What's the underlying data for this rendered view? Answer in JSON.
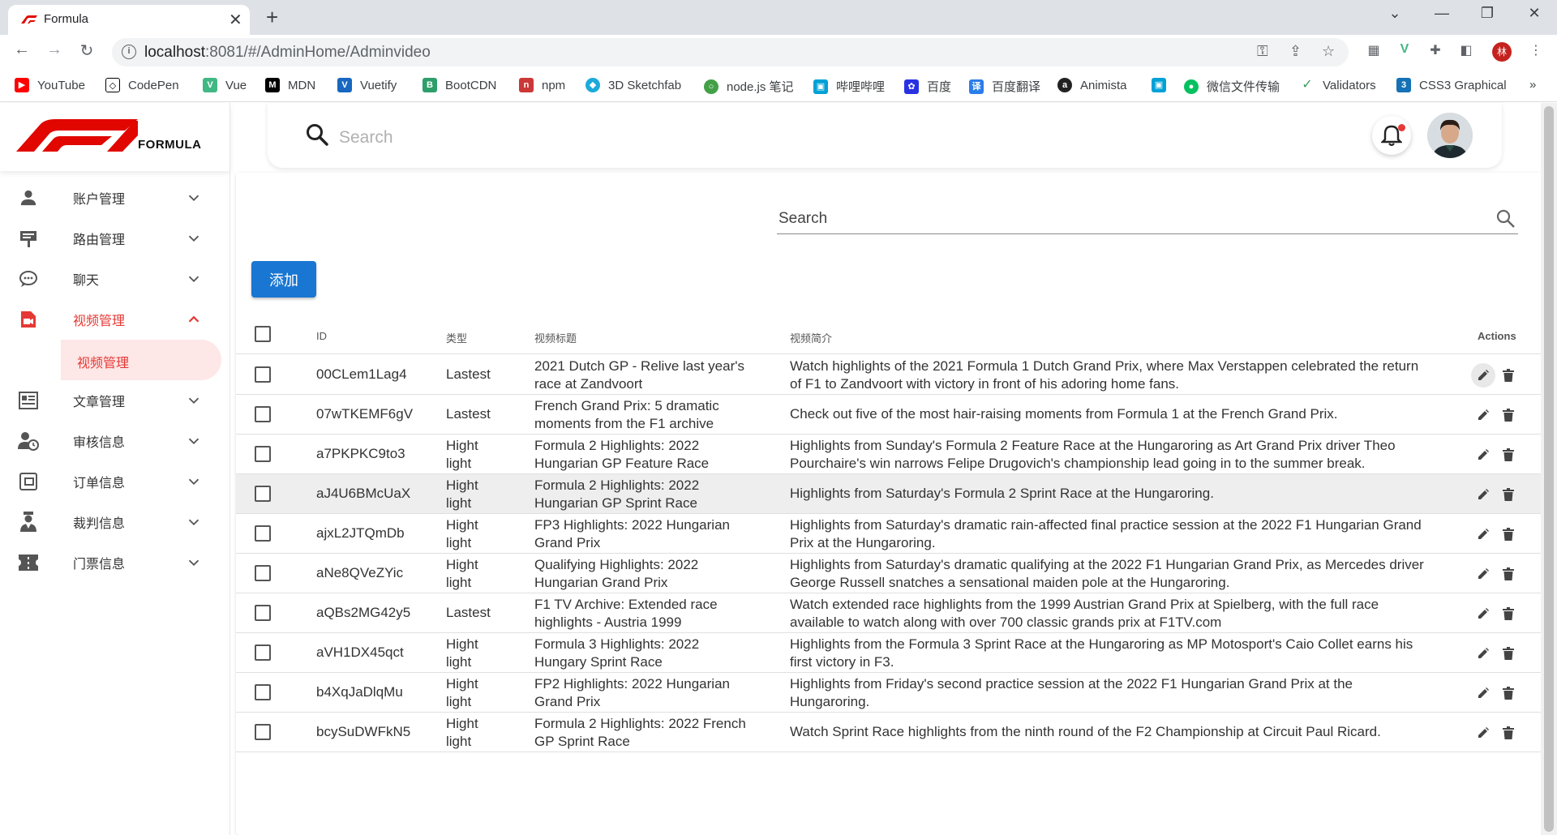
{
  "browser": {
    "tab_title": "Formula",
    "url_host": "localhost",
    "url_rest": ":8081/#/AdminHome/Adminvideo",
    "profile_initial": "林",
    "bookmarks": [
      "YouTube",
      "CodePen",
      "Vue",
      "MDN",
      "Vuetify",
      "BootCDN",
      "npm",
      "3D Sketchfab",
      "node.js 笔记",
      "哔哩哔哩",
      "百度",
      "百度翻译",
      "Animista",
      "",
      "微信文件传输",
      "Validators",
      "CSS3 Graphical"
    ],
    "more": "»"
  },
  "app": {
    "brand": "FORMULA",
    "search_placeholder": "Search",
    "nav": [
      {
        "label": "账户管理",
        "icon": "person-icon"
      },
      {
        "label": "路由管理",
        "icon": "signpost-icon"
      },
      {
        "label": "聊天",
        "icon": "chat-icon"
      },
      {
        "label": "视频管理",
        "icon": "video-icon"
      },
      {
        "label": "文章管理",
        "icon": "article-icon"
      },
      {
        "label": "审核信息",
        "icon": "user-clock-icon"
      },
      {
        "label": "订单信息",
        "icon": "order-icon"
      },
      {
        "label": "裁判信息",
        "icon": "referee-icon"
      },
      {
        "label": "门票信息",
        "icon": "ticket-icon"
      }
    ],
    "subnav_label": "视频管理",
    "accent_color": "#e53935",
    "primary_color": "#1976d2"
  },
  "table": {
    "search_label": "Search",
    "add_label": "添加",
    "headers": {
      "id": "ID",
      "type": "类型",
      "title": "视频标题",
      "desc": "视频简介",
      "actions": "Actions"
    },
    "rows": [
      {
        "id": "00CLem1Lag4",
        "type": [
          "Lastest"
        ],
        "title": [
          "2021 Dutch GP - Relive last year's",
          "race at Zandvoort"
        ],
        "desc": [
          "Watch highlights of the 2021 Formula 1 Dutch Grand Prix, where Max Verstappen celebrated the return",
          "of F1 to Zandvoort with victory in front of his adoring home fans."
        ]
      },
      {
        "id": "07wTKEMF6gV",
        "type": [
          "Lastest"
        ],
        "title": [
          "French Grand Prix: 5 dramatic",
          "moments from the F1 archive"
        ],
        "desc": [
          "Check out five of the most hair-raising moments from Formula 1 at the French Grand Prix."
        ]
      },
      {
        "id": "a7PKPKC9to3",
        "type": [
          "Hight",
          "light"
        ],
        "title": [
          "Formula 2 Highlights: 2022",
          "Hungarian GP Feature Race"
        ],
        "desc": [
          "Highlights from Sunday's Formula 2 Feature Race at the Hungaroring as Art Grand Prix driver Theo",
          "Pourchaire's win narrows Felipe Drugovich's championship lead going in to the summer break."
        ]
      },
      {
        "id": "aJ4U6BMcUaX",
        "type": [
          "Hight",
          "light"
        ],
        "title": [
          "Formula 2 Highlights: 2022",
          "Hungarian GP Sprint Race"
        ],
        "desc": [
          "Highlights from Saturday's Formula 2 Sprint Race at the Hungaroring."
        ]
      },
      {
        "id": "ajxL2JTQmDb",
        "type": [
          "Hight",
          "light"
        ],
        "title": [
          "FP3 Highlights: 2022 Hungarian",
          "Grand Prix"
        ],
        "desc": [
          "Highlights from Saturday's dramatic rain-affected final practice session at the 2022 F1 Hungarian Grand",
          "Prix at the Hungaroring."
        ]
      },
      {
        "id": "aNe8QVeZYic",
        "type": [
          "Hight",
          "light"
        ],
        "title": [
          "Qualifying Highlights: 2022",
          "Hungarian Grand Prix"
        ],
        "desc": [
          "Highlights from Saturday's dramatic qualifying at the 2022 F1 Hungarian Grand Prix, as Mercedes driver",
          "George Russell snatches a sensational maiden pole at the Hungaroring."
        ]
      },
      {
        "id": "aQBs2MG42y5",
        "type": [
          "Lastest"
        ],
        "title": [
          "F1 TV Archive: Extended race",
          "highlights - Austria 1999"
        ],
        "desc": [
          "Watch extended race highlights from the 1999 Austrian Grand Prix at Spielberg, with the full race",
          "available to watch along with over 700 classic grands prix at F1TV.com"
        ]
      },
      {
        "id": "aVH1DX45qct",
        "type": [
          "Hight",
          "light"
        ],
        "title": [
          "Formula 3 Highlights: 2022",
          "Hungary Sprint Race"
        ],
        "desc": [
          "Highlights from the Formula 3 Sprint Race at the Hungaroring as MP Motosport's Caio Collet earns his",
          "first victory in F3."
        ]
      },
      {
        "id": "b4XqJaDlqMu",
        "type": [
          "Hight",
          "light"
        ],
        "title": [
          "FP2 Highlights: 2022 Hungarian",
          "Grand Prix"
        ],
        "desc": [
          "Highlights from Friday's second practice session at the 2022 F1 Hungarian Grand Prix at the",
          "Hungaroring."
        ]
      },
      {
        "id": "bcySuDWFkN5",
        "type": [
          "Hight",
          "light"
        ],
        "title": [
          "Formula 2 Highlights: 2022 French",
          "GP Sprint Race"
        ],
        "desc": [
          "Watch Sprint Race highlights from the ninth round of the F2 Championship at Circuit Paul Ricard."
        ]
      }
    ]
  }
}
